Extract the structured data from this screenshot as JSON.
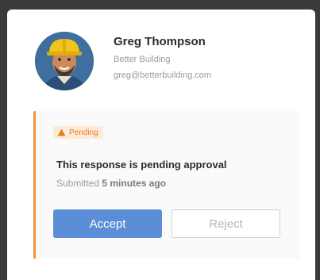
{
  "contact": {
    "name": "Greg Thompson",
    "company": "Better Building",
    "email": "greg@betterbuilding.com",
    "avatar_icon": "worker-hardhat-avatar"
  },
  "status": {
    "badge_label": "Pending",
    "badge_icon": "warning-triangle-icon",
    "accent_color": "#f0923a",
    "heading": "This response is pending approval",
    "submitted_prefix": "Submitted",
    "submitted_time": "5 minutes ago"
  },
  "actions": {
    "accept_label": "Accept",
    "reject_label": "Reject",
    "accept_color": "#5b8ed6"
  }
}
